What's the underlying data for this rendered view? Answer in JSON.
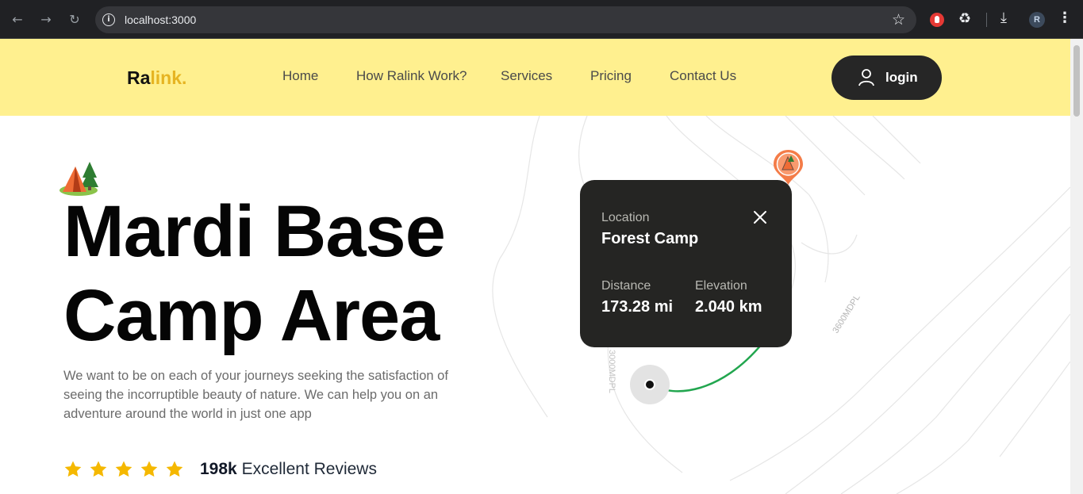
{
  "browser": {
    "back_icon": "arrow-left-icon",
    "forward_icon": "arrow-right-icon",
    "reload_icon": "reload-icon",
    "url": "localhost:3000",
    "profile_initial": "R"
  },
  "header": {
    "logo_main": "Ra",
    "logo_accent": "link.",
    "nav": [
      "Home",
      "How Ralink Work?",
      "Services",
      "Pricing",
      "Contact Us"
    ],
    "login_label": "login",
    "background": "#fff08f"
  },
  "hero": {
    "title_line1": "Mardi Base",
    "title_line2": "Camp Area",
    "description": "We want to be on each of your journeys seeking the satisfaction of seeing the incorruptible beauty of nature. We can help you on an adventure around the world in just one app",
    "rating_stars": 5,
    "reviews_count": "198k",
    "reviews_label": "Excellent Reviews",
    "star_color": "#f5b800"
  },
  "map": {
    "contour_label_1": "3600MDPL",
    "contour_label_2": "3000MDPL",
    "route_color": "#22a64f",
    "pin_color": "#f47c48"
  },
  "location_card": {
    "location_label": "Location",
    "location_value": "Forest Camp",
    "distance_label": "Distance",
    "distance_value": "173.28 mi",
    "elevation_label": "Elevation",
    "elevation_value": "2.040 km"
  }
}
